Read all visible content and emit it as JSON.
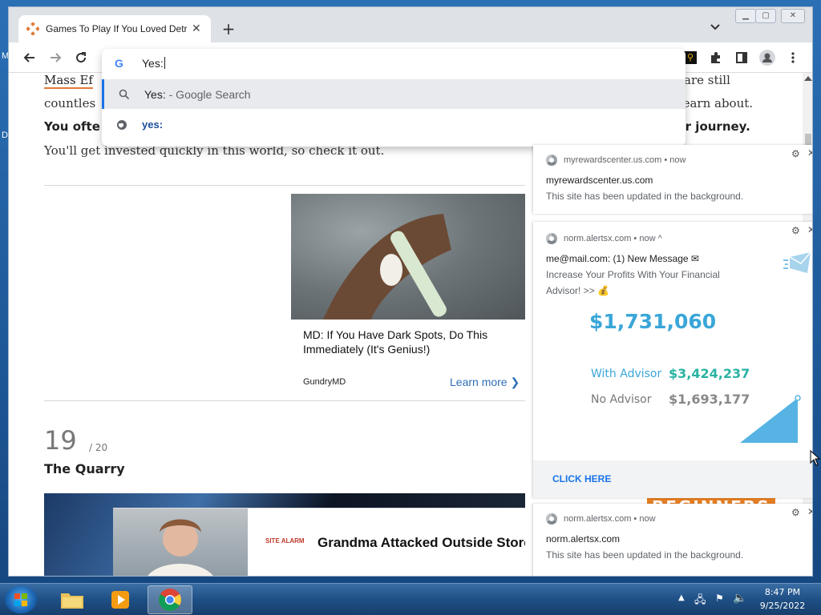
{
  "desktop": {
    "edge_letter_top": "M",
    "edge_letter_mid": "D"
  },
  "browser": {
    "tab": {
      "title": "Games To Play If You Loved Detroit: Become Human",
      "close": "✕"
    },
    "new_tab": "+",
    "omnibox": {
      "value": "Yes:",
      "suggestions": [
        {
          "text": "Yes:",
          "suffix": " - Google Search",
          "icon": "search-icon"
        },
        {
          "text": "yes:",
          "suffix": "",
          "icon": "globe-icon"
        }
      ]
    }
  },
  "page": {
    "lines": {
      "l1": "Mass Ef",
      "l1b": "are still",
      "l2": "countles",
      "l2b": "o learn about.",
      "l3": "You ofte",
      "l3b": "ur journey.",
      "l4": "You'll get invested quickly in this world, so check it out."
    },
    "ad": {
      "title": "MD: If You Have Dark Spots, Do This Immediately (It's Genius!)",
      "brand": "GundryMD",
      "link": "Learn more ❯"
    },
    "entry": {
      "rank": "19",
      "total": "/ 20",
      "title": "The Quarry"
    },
    "bottom_ad": {
      "logo": "SITE ALARM",
      "title": "Grandma Attacked Outside Store"
    },
    "banner_text": "BEGINNERS"
  },
  "notifications": [
    {
      "site": "myrewardscenter.us.com",
      "time": "now",
      "title": "myrewardscenter.us.com",
      "body": "This site has been updated in the background."
    },
    {
      "site": "norm.alertsx.com",
      "time": "now ^",
      "title": "me@mail.com: (1) New Message ✉",
      "body1": " Increase Your Profits With Your Financial",
      "body2": "Advisor! >> 💰",
      "amount": "$1,731,060",
      "with_label": "With Advisor",
      "with_value": "$3,424,237",
      "no_label": "No Advisor",
      "no_value": "$1,693,177",
      "cta": "CLICK HERE"
    },
    {
      "site": "norm.alertsx.com",
      "time": "now",
      "title": "norm.alertsx.com",
      "body": "This site has been updated in the background."
    }
  ],
  "taskbar": {
    "time": "8:47 PM",
    "date": "9/25/2022"
  },
  "colors": {
    "accent": "#1a73e8",
    "finance_blue": "#3aa6d8",
    "finance_green": "#2bb3a3"
  }
}
